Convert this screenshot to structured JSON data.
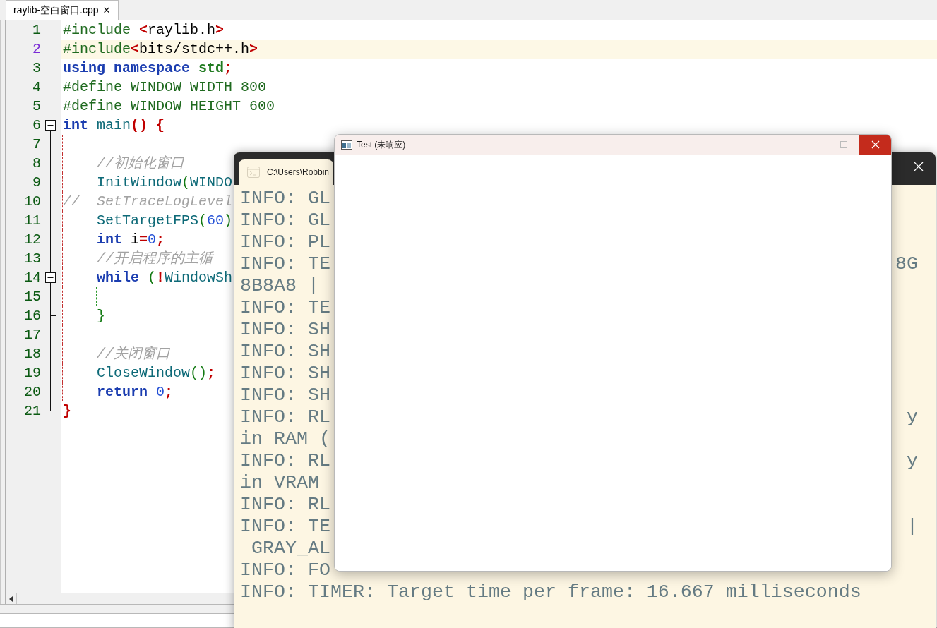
{
  "editor": {
    "tab": {
      "label": "raylib-空白窗口.cpp",
      "close": "✕",
      "selected": true
    },
    "lines": [
      {
        "number": "1",
        "selected": false,
        "kind": "plain",
        "segments": [
          {
            "text": "#include ",
            "kind": "pre"
          },
          {
            "text": "<",
            "kind": "punct"
          },
          {
            "text": "raylib.h",
            "kind": "plain"
          },
          {
            "text": ">",
            "kind": "punct"
          }
        ]
      },
      {
        "number": "2",
        "selected": true,
        "kind": "plain",
        "segments": [
          {
            "text": "#include",
            "kind": "pre"
          },
          {
            "text": "<",
            "kind": "punct"
          },
          {
            "text": "bits/stdc++.h",
            "kind": "plain"
          },
          {
            "text": ">",
            "kind": "punct"
          }
        ]
      },
      {
        "number": "3",
        "selected": false,
        "kind": "plain",
        "segments": [
          {
            "text": "using namespace ",
            "kind": "kw"
          },
          {
            "text": "std",
            "kind": "ns"
          },
          {
            "text": ";",
            "kind": "punct"
          }
        ]
      },
      {
        "number": "4",
        "selected": false,
        "kind": "plain",
        "segments": [
          {
            "text": "#define WINDOW_WIDTH 800",
            "kind": "pre"
          }
        ]
      },
      {
        "number": "5",
        "selected": false,
        "kind": "plain",
        "segments": [
          {
            "text": "#define WINDOW_HEIGHT 600",
            "kind": "pre"
          }
        ]
      },
      {
        "number": "6",
        "selected": false,
        "kind": "fold_start",
        "segments": [
          {
            "text": "int",
            "kind": "kw"
          },
          {
            "text": " main",
            "kind": "fn"
          },
          {
            "text": "() {",
            "kind": "punct"
          }
        ]
      },
      {
        "number": "7",
        "selected": false,
        "kind": "fold_body"
      },
      {
        "number": "8",
        "selected": false,
        "kind": "fold_body",
        "segments": [
          {
            "text": "    //初始化窗口",
            "kind": "comment"
          }
        ]
      },
      {
        "number": "9",
        "selected": false,
        "kind": "fold_body",
        "segments": [
          {
            "text": "    InitWindow",
            "kind": "fn"
          },
          {
            "text": "(",
            "kind": "paren"
          },
          {
            "text": "WINDO",
            "kind": "fn"
          }
        ]
      },
      {
        "number": "10",
        "selected": false,
        "kind": "fold_body",
        "segments": [
          {
            "text": "//  SetTraceLogLevel",
            "kind": "comment"
          }
        ]
      },
      {
        "number": "11",
        "selected": false,
        "kind": "fold_body",
        "segments": [
          {
            "text": "    SetTargetFPS",
            "kind": "fn"
          },
          {
            "text": "(",
            "kind": "paren"
          },
          {
            "text": "60",
            "kind": "num"
          },
          {
            "text": ")",
            "kind": "paren"
          }
        ]
      },
      {
        "number": "12",
        "selected": false,
        "kind": "fold_body",
        "segments": [
          {
            "text": "    int",
            "kind": "kw"
          },
          {
            "text": " i",
            "kind": "plain"
          },
          {
            "text": "=",
            "kind": "punct"
          },
          {
            "text": "0",
            "kind": "num"
          },
          {
            "text": ";",
            "kind": "punct"
          }
        ]
      },
      {
        "number": "13",
        "selected": false,
        "kind": "fold_body",
        "segments": [
          {
            "text": "    //开启程序的主循",
            "kind": "comment"
          }
        ]
      },
      {
        "number": "14",
        "selected": false,
        "kind": "fold_start",
        "segments": [
          {
            "text": "    while",
            "kind": "kw"
          },
          {
            "text": " (",
            "kind": "paren"
          },
          {
            "text": "!",
            "kind": "punct"
          },
          {
            "text": "WindowSh",
            "kind": "fn"
          }
        ]
      },
      {
        "number": "15",
        "selected": false,
        "kind": "fold_body"
      },
      {
        "number": "16",
        "selected": false,
        "kind": "fold_end",
        "segments": [
          {
            "text": "    }",
            "kind": "paren"
          }
        ]
      },
      {
        "number": "17",
        "selected": false,
        "kind": "fold_body"
      },
      {
        "number": "18",
        "selected": false,
        "kind": "fold_body",
        "segments": [
          {
            "text": "    //关闭窗口",
            "kind": "comment"
          }
        ]
      },
      {
        "number": "19",
        "selected": false,
        "kind": "fold_body",
        "segments": [
          {
            "text": "    CloseWindow",
            "kind": "fn"
          },
          {
            "text": "()",
            "kind": "paren"
          },
          {
            "text": ";",
            "kind": "punct"
          }
        ]
      },
      {
        "number": "20",
        "selected": false,
        "kind": "fold_body",
        "segments": [
          {
            "text": "    return",
            "kind": "kw"
          },
          {
            "text": " 0",
            "kind": "num"
          },
          {
            "text": ";",
            "kind": "punct"
          }
        ]
      },
      {
        "number": "21",
        "selected": false,
        "kind": "fold_end",
        "segments": [
          {
            "text": "}",
            "kind": "punct"
          }
        ]
      }
    ]
  },
  "console": {
    "tab_title": "C:\\Users\\Robbin",
    "lines": [
      {
        "text": "INFO: GL"
      },
      {
        "text": "INFO: GL"
      },
      {
        "text": "INFO: PL"
      },
      {
        "text": "INFO: TE",
        "tail": "8G"
      },
      {
        "text": "8B8A8 |"
      },
      {
        "text": "INFO: TE"
      },
      {
        "text": "INFO: SH"
      },
      {
        "text": "INFO: SH"
      },
      {
        "text": "INFO: SH"
      },
      {
        "text": "INFO: SH"
      },
      {
        "text": "INFO: RL",
        "tail": "y"
      },
      {
        "text": "in RAM ("
      },
      {
        "text": "INFO: RL",
        "tail": "y"
      },
      {
        "text": "in VRAM"
      },
      {
        "text": "INFO: RL"
      },
      {
        "text": "INFO: TE",
        "tail": "|"
      },
      {
        "text": " GRAY_AL"
      },
      {
        "text": "INFO: FO"
      },
      {
        "text": "INFO: TIMER: Target time per frame: 16.667 milliseconds"
      }
    ]
  },
  "app_window": {
    "title": "Test (未响应)"
  }
}
